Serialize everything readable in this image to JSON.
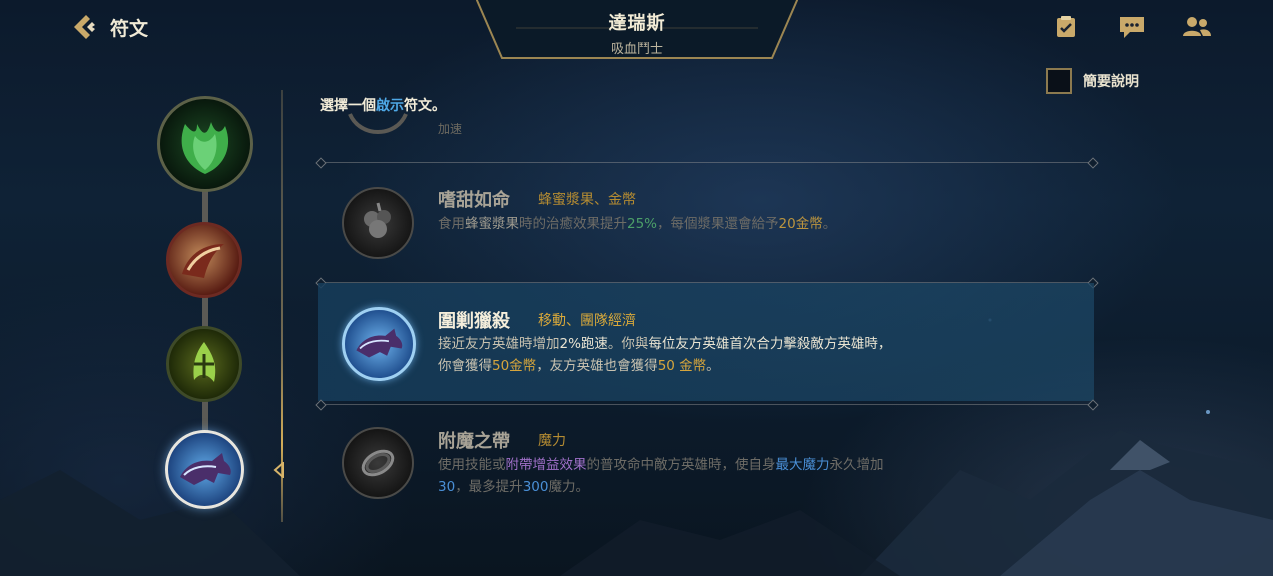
{
  "header": {
    "back_title": "符文",
    "champion_name": "達瑞斯",
    "champion_role": "吸血鬥士",
    "icons": [
      "checklist-icon",
      "chat-icon",
      "friends-icon"
    ]
  },
  "summary_toggle": {
    "label": "簡要說明",
    "checked": false
  },
  "instruction": {
    "prefix": "選擇一個",
    "highlight": "啟示",
    "suffix": "符文。"
  },
  "stub": {
    "text": "加速"
  },
  "runes": [
    {
      "name": "嗜甜如命",
      "tags": "蜂蜜漿果、金幣",
      "selected": false,
      "desc": {
        "p1": "食用",
        "p2": "蜂蜜漿果",
        "p3": "時的治癒效果提升",
        "p4": "25%",
        "p5": "，每個漿果還會給予",
        "p6": "20金幣",
        "p7": "。"
      }
    },
    {
      "name": "圍剿獵殺",
      "tags": "移動、團隊經濟",
      "selected": true,
      "desc": {
        "p1": "接近友方英雄時增加",
        "p2": "2%跑速",
        "p3": "。你與",
        "p4": "每位友方英雄首次合力擊殺敵方英雄時，",
        "p5": "你會獲得",
        "p6": "50金幣",
        "p7": "，友方英雄也會獲得",
        "p8": "50 金幣",
        "p9": "。"
      }
    },
    {
      "name": "附魔之帶",
      "tags": "魔力",
      "selected": false,
      "desc": {
        "p1": "使用技能或",
        "p2": "附帶增益效果",
        "p3": "的普攻命中敵方英雄時，使自身",
        "p4": "最大魔力",
        "p5": "永久增加",
        "p6": "30",
        "p7": "，最多提升",
        "p8": "300",
        "p9": "魔力。"
      }
    }
  ],
  "colors": {
    "accent_gold": "#d9a93a",
    "highlight_blue": "#4ea8e6",
    "selected_row": "#1c4664"
  }
}
